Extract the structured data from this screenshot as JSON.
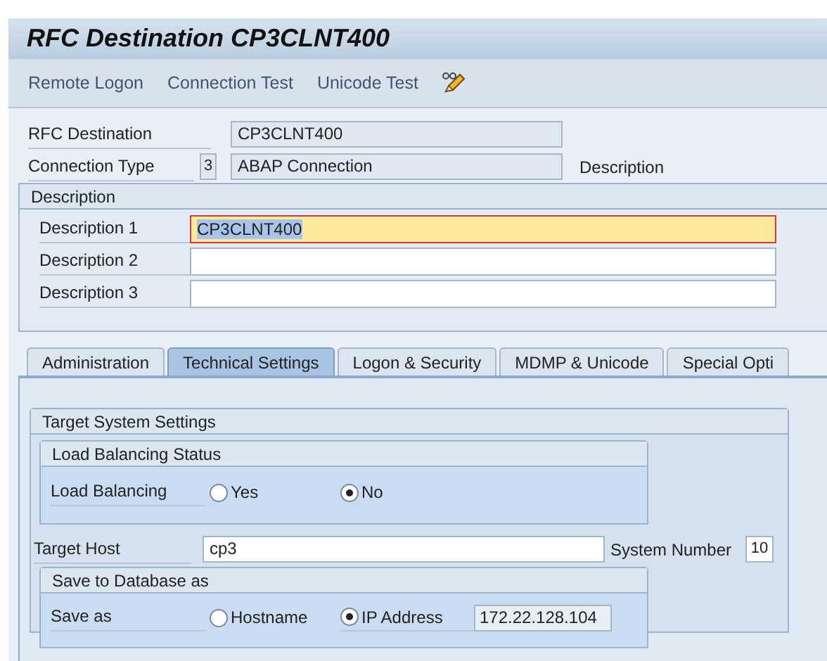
{
  "window": {
    "title": "RFC Destination CP3CLNT400"
  },
  "toolbar": [
    {
      "label": "Remote Logon"
    },
    {
      "label": "Connection Test"
    },
    {
      "label": "Unicode Test"
    },
    {
      "kind": "icon"
    }
  ],
  "header_fields": {
    "rfc_destination": {
      "label": "RFC Destination",
      "value": "CP3CLNT400"
    },
    "connection_type": {
      "label": "Connection Type",
      "code": "3",
      "value": "ABAP Connection",
      "description_label": "Description"
    }
  },
  "description": {
    "title": "Description",
    "fields": [
      {
        "label": "Description 1",
        "value": "CP3CLNT400",
        "focused": true
      },
      {
        "label": "Description 2",
        "focused": false
      },
      {
        "label": "Description 3",
        "focused": false
      }
    ]
  },
  "tabs": [
    {
      "label": "Administration",
      "selected": false
    },
    {
      "label": "Technical Settings",
      "selected": true
    },
    {
      "label": "Logon & Security",
      "selected": false
    },
    {
      "label": "MDMP & Unicode",
      "selected": false
    },
    {
      "label": "Special Opti",
      "selected": false
    }
  ],
  "target_system": {
    "title": "Target System Settings",
    "load_balancing_status": {
      "title": "Load Balancing Status",
      "label": "Load Balancing",
      "options": [
        {
          "label": "Yes",
          "selected": false
        },
        {
          "label": "No",
          "selected": true
        }
      ]
    },
    "target_host": {
      "label": "Target Host",
      "value": "cp3"
    },
    "system_number": {
      "label": "System Number",
      "value": "10"
    },
    "save_to_database": {
      "title": "Save to Database as",
      "label": "Save as",
      "options": [
        {
          "label": "Hostname",
          "selected": false
        },
        {
          "label": "IP Address",
          "selected": true
        }
      ],
      "ip_address": "172.22.128.104"
    }
  }
}
